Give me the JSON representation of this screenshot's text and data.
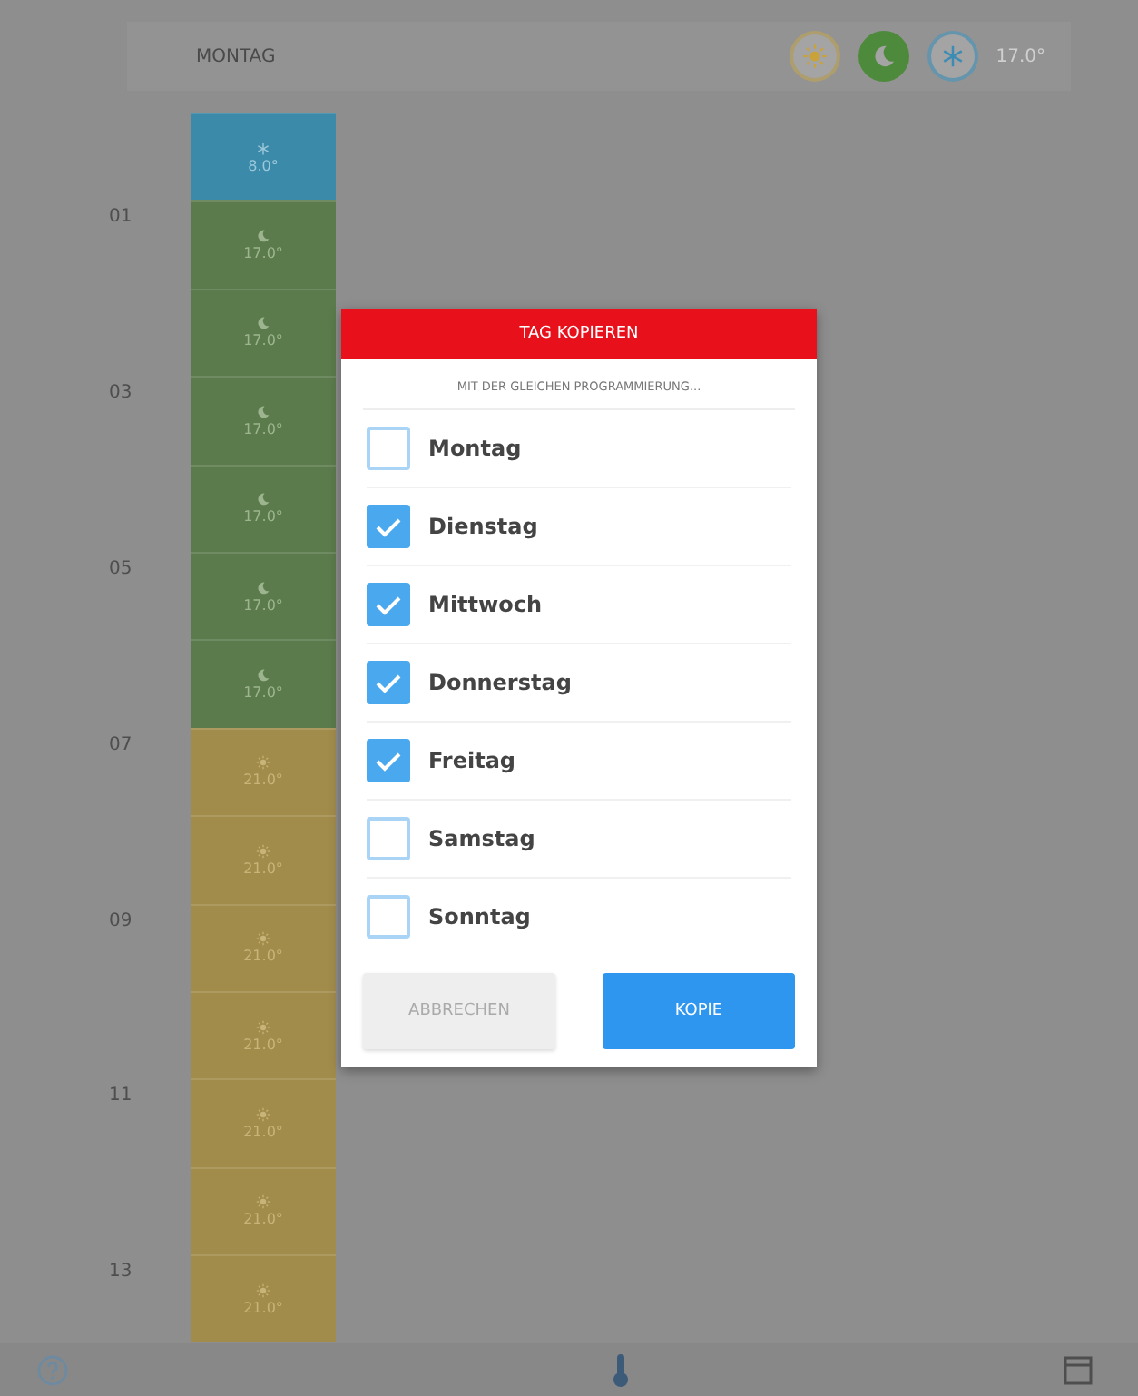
{
  "header": {
    "day": "MONTAG",
    "modes": [
      {
        "kind": "sun",
        "selected": false
      },
      {
        "kind": "moon",
        "selected": true
      },
      {
        "kind": "snowflake",
        "selected": false
      }
    ],
    "temperature": "17.0°"
  },
  "slots": [
    {
      "kind": "snowflake",
      "temperature": "8.0°"
    },
    {
      "hour": "01",
      "kind": "moon",
      "temperature": "17.0°"
    },
    {
      "kind": "moon",
      "temperature": "17.0°"
    },
    {
      "hour": "03",
      "kind": "moon",
      "temperature": "17.0°"
    },
    {
      "kind": "moon",
      "temperature": "17.0°"
    },
    {
      "hour": "05",
      "kind": "moon",
      "temperature": "17.0°"
    },
    {
      "kind": "moon",
      "temperature": "17.0°"
    },
    {
      "hour": "07",
      "kind": "sun",
      "temperature": "21.0°"
    },
    {
      "kind": "sun",
      "temperature": "21.0°"
    },
    {
      "hour": "09",
      "kind": "sun",
      "temperature": "21.0°"
    },
    {
      "kind": "sun",
      "temperature": "21.0°"
    },
    {
      "hour": "11",
      "kind": "sun",
      "temperature": "21.0°"
    },
    {
      "kind": "sun",
      "temperature": "21.0°"
    },
    {
      "hour": "13",
      "kind": "sun",
      "temperature": "21.0°"
    }
  ],
  "dialog": {
    "title": "TAG KOPIEREN",
    "subtitle": "MIT DER GLEICHEN PROGRAMMIERUNG...",
    "days": [
      {
        "label": "Montag",
        "checked": false
      },
      {
        "label": "Dienstag",
        "checked": true
      },
      {
        "label": "Mittwoch",
        "checked": true
      },
      {
        "label": "Donnerstag",
        "checked": true
      },
      {
        "label": "Freitag",
        "checked": true
      },
      {
        "label": "Samstag",
        "checked": false
      },
      {
        "label": "Sonntag",
        "checked": false
      }
    ],
    "buttons": [
      {
        "kind": "cancel",
        "label": "ABBRECHEN"
      },
      {
        "kind": "confirm",
        "label": "KOPIE"
      }
    ]
  }
}
